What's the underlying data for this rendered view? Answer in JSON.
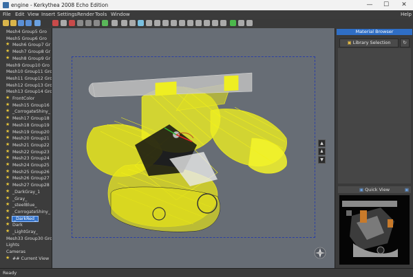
{
  "window": {
    "title": "engine - Kerkythea 2008 Echo Edition",
    "minimize": "—",
    "maximize": "☐",
    "close": "✕"
  },
  "menu": {
    "items": [
      "File",
      "Edit",
      "View",
      "Insert",
      "Settings",
      "Render",
      "Tools",
      "Window"
    ],
    "help": "Help"
  },
  "toolbar": {
    "icons": [
      "new-icon",
      "open-icon",
      "save-icon",
      "saveas-icon",
      "undo-icon",
      "render-icon",
      "stop-icon",
      "camera-icon",
      "rotate-icon",
      "pan-icon",
      "zoom-icon",
      "select-icon",
      "move-icon",
      "scale-icon",
      "light-icon",
      "material-icon",
      "texture-icon",
      "grid-icon",
      "wireframe-icon",
      "solid-icon",
      "shade-icon",
      "box-icon",
      "sphere-icon",
      "cylinder-icon",
      "plane-icon",
      "export-icon",
      "green-icon",
      "help-icon",
      "close-icon"
    ]
  },
  "tree": {
    "items": [
      {
        "label": "Mesh4 Group5 Gro",
        "star": false
      },
      {
        "label": "Mesh5 Group6 Gro",
        "star": false
      },
      {
        "label": "Mesh6 Group7 Gr",
        "star": true
      },
      {
        "label": "Mesh7 Group8 Gr",
        "star": true
      },
      {
        "label": "Mesh8 Group9 Gr",
        "star": true
      },
      {
        "label": "Mesh9 Group10 Gro",
        "star": false
      },
      {
        "label": "Mesh10 Group11 Gro",
        "star": false
      },
      {
        "label": "Mesh11 Group12 Gro",
        "star": false
      },
      {
        "label": "Mesh12 Group13 Gro",
        "star": false
      },
      {
        "label": "Mesh13 Group14 Gro",
        "star": false
      },
      {
        "label": "FrontColor",
        "star": true
      },
      {
        "label": "Mesh15 Group16",
        "star": true
      },
      {
        "label": "_CorrogateShiny_",
        "star": true
      },
      {
        "label": "Mesh17 Group18",
        "star": true
      },
      {
        "label": "Mesh18 Group19",
        "star": true
      },
      {
        "label": "Mesh19 Group20",
        "star": true
      },
      {
        "label": "Mesh20 Group21",
        "star": true
      },
      {
        "label": "Mesh21 Group22",
        "star": true
      },
      {
        "label": "Mesh22 Group23",
        "star": true
      },
      {
        "label": "Mesh23 Group24",
        "star": true
      },
      {
        "label": "Mesh24 Group25",
        "star": true
      },
      {
        "label": "Mesh25 Group26",
        "star": true
      },
      {
        "label": "Mesh26 Group27",
        "star": true
      },
      {
        "label": "Mesh27 Group28",
        "star": true
      },
      {
        "label": "_DarkGray_1",
        "star": true
      },
      {
        "label": "_Gray_",
        "star": true
      },
      {
        "label": "_steelBlue_",
        "star": true
      },
      {
        "label": "_CorrogateShiny_",
        "star": true
      },
      {
        "label": "_DarkRed_",
        "star": true,
        "selected": true
      },
      {
        "label": "Dark",
        "star": true
      },
      {
        "label": "_LightGray_",
        "star": true
      },
      {
        "label": "Mesh33 Group30 Gro",
        "star": false
      },
      {
        "label": "Lights",
        "star": false
      },
      {
        "label": "Cameras",
        "star": false
      },
      {
        "label": "## Current View",
        "star": true
      }
    ]
  },
  "right": {
    "material_browser": "Material Browser",
    "library_selection": "Library Selection",
    "quick_view": "Quick View"
  },
  "status": {
    "text": "Ready"
  },
  "colors": {
    "accent": "#2f6ec5",
    "wireframe": "#f2f01a",
    "viewport": "#676d75"
  }
}
